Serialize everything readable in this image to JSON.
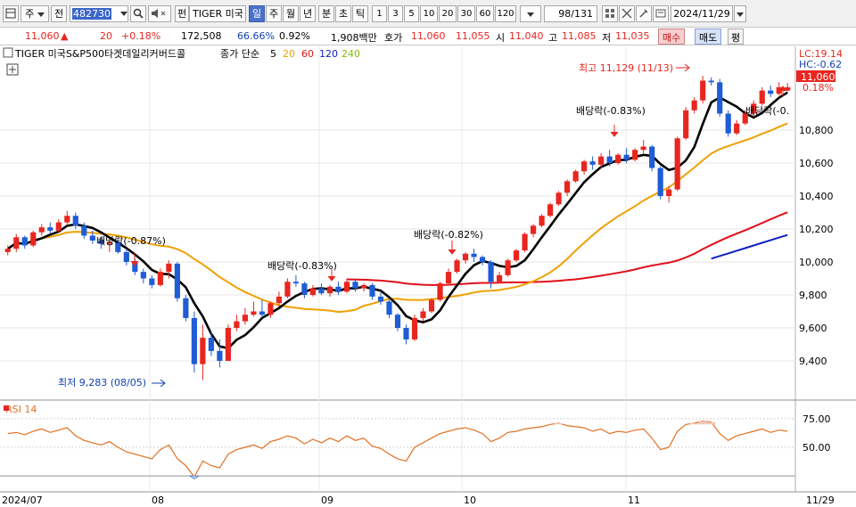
{
  "toolbar": {
    "mode_label": "주",
    "prev_label": "전",
    "code_value": "482730",
    "fund_label": "펀",
    "name_value": "TIGER 미국",
    "periods": [
      "일",
      "주",
      "월",
      "년",
      "분",
      "초",
      "틱"
    ],
    "active_period": "일",
    "counts": [
      "1",
      "3",
      "5",
      "10",
      "20",
      "30",
      "60",
      "120"
    ],
    "page_counter": "98/131",
    "date_value": "2024/11/29"
  },
  "quote": {
    "price": "11,060",
    "change": "20",
    "change_pct": "+0.18%",
    "volume": "172,508",
    "ratio1": "66.66%",
    "ratio2": "0.92%",
    "amount": "1,908백만",
    "hoga_label": "호가",
    "hoga_ask": "11,060",
    "hoga_bid": "11,055",
    "open_label": "시",
    "open": "11,040",
    "high_label": "고",
    "high": "11,085",
    "low_label": "저",
    "low": "11,035",
    "buy_label": "매수",
    "sell_label": "매도",
    "avg_label": "평"
  },
  "legend": {
    "title": "TIGER 미국S&P500타겟데일리커버드콜",
    "price_type": "종가 단순",
    "ma": [
      {
        "period": "5",
        "color": "#000000"
      },
      {
        "period": "20",
        "color": "#f0a000"
      },
      {
        "period": "60",
        "color": "#e0101a"
      },
      {
        "period": "120",
        "color": "#1020c0"
      },
      {
        "period": "240",
        "color": "#80c000"
      }
    ]
  },
  "annotations": {
    "high": "최고 11,129 (11/13)",
    "low": "최저 9,283 (08/05)",
    "div1": "배당락(-0.87%)",
    "div2": "배당락(-0.83%)",
    "div3": "배당락(-0.82%)",
    "div4": "배당락(-0.83%)",
    "div5": "배당락(-0.",
    "lc": "LC:19.14",
    "hc": "HC:-0.62",
    "last_price": "11,060",
    "last_pct": "0.18%"
  },
  "rsi": {
    "label": "RSI 14",
    "period": 14
  },
  "colors": {
    "up": "#e8261f",
    "down": "#1f5cd6",
    "ma5": "#000000",
    "ma20": "#f0a000",
    "ma60": "#e0101a",
    "ma120": "#1020c0",
    "rsi": "#e07020"
  },
  "chart_data": {
    "type": "candlestick",
    "y_ticks": [
      9400,
      9600,
      9800,
      10000,
      10200,
      10400,
      10600,
      10800
    ],
    "ylim": [
      9200,
      11200
    ],
    "x_labels": [
      "2024/07",
      "08",
      "09",
      "10",
      "11",
      "11/29"
    ],
    "rsi_ticks": [
      "75.00",
      "50.00"
    ],
    "ohlc": [
      [
        10060,
        10100,
        10040,
        10080
      ],
      [
        10080,
        10170,
        10060,
        10150
      ],
      [
        10150,
        10160,
        10080,
        10100
      ],
      [
        10100,
        10190,
        10090,
        10180
      ],
      [
        10180,
        10230,
        10160,
        10210
      ],
      [
        10210,
        10240,
        10170,
        10190
      ],
      [
        10190,
        10260,
        10180,
        10240
      ],
      [
        10240,
        10310,
        10220,
        10280
      ],
      [
        10280,
        10300,
        10200,
        10220
      ],
      [
        10220,
        10240,
        10140,
        10160
      ],
      [
        10160,
        10190,
        10110,
        10130
      ],
      [
        10130,
        10150,
        10080,
        10110
      ],
      [
        10110,
        10140,
        10060,
        10120
      ],
      [
        10120,
        10130,
        10050,
        10060
      ],
      [
        10060,
        10080,
        9980,
        10000
      ],
      [
        10000,
        10020,
        9920,
        9940
      ],
      [
        9940,
        9960,
        9870,
        9900
      ],
      [
        9900,
        9920,
        9840,
        9860
      ],
      [
        9860,
        9960,
        9850,
        9940
      ],
      [
        9940,
        10010,
        9900,
        9990
      ],
      [
        9990,
        10000,
        9760,
        9780
      ],
      [
        9780,
        9800,
        9640,
        9660
      ],
      [
        9660,
        9700,
        9330,
        9380
      ],
      [
        9380,
        9620,
        9283,
        9540
      ],
      [
        9540,
        9580,
        9430,
        9460
      ],
      [
        9460,
        9530,
        9360,
        9400
      ],
      [
        9400,
        9620,
        9400,
        9600
      ],
      [
        9600,
        9680,
        9580,
        9640
      ],
      [
        9640,
        9720,
        9620,
        9680
      ],
      [
        9680,
        9760,
        9670,
        9700
      ],
      [
        9700,
        9770,
        9660,
        9680
      ],
      [
        9680,
        9760,
        9660,
        9750
      ],
      [
        9750,
        9820,
        9730,
        9790
      ],
      [
        9790,
        9900,
        9780,
        9880
      ],
      [
        9880,
        9920,
        9850,
        9870
      ],
      [
        9870,
        9880,
        9780,
        9800
      ],
      [
        9800,
        9860,
        9790,
        9840
      ],
      [
        9840,
        9870,
        9800,
        9810
      ],
      [
        9810,
        9860,
        9790,
        9850
      ],
      [
        9850,
        9880,
        9800,
        9820
      ],
      [
        9820,
        9900,
        9810,
        9880
      ],
      [
        9880,
        9900,
        9820,
        9840
      ],
      [
        9840,
        9870,
        9820,
        9860
      ],
      [
        9860,
        9870,
        9770,
        9790
      ],
      [
        9790,
        9820,
        9740,
        9760
      ],
      [
        9760,
        9770,
        9660,
        9680
      ],
      [
        9680,
        9690,
        9580,
        9600
      ],
      [
        9600,
        9620,
        9500,
        9530
      ],
      [
        9530,
        9680,
        9520,
        9660
      ],
      [
        9660,
        9720,
        9640,
        9700
      ],
      [
        9700,
        9780,
        9690,
        9770
      ],
      [
        9770,
        9880,
        9760,
        9870
      ],
      [
        9870,
        9960,
        9860,
        9940
      ],
      [
        9940,
        10020,
        9930,
        10010
      ],
      [
        10010,
        10060,
        9990,
        10050
      ],
      [
        10050,
        10080,
        10000,
        10030
      ],
      [
        10030,
        10040,
        9980,
        10000
      ],
      [
        10000,
        10010,
        9840,
        9880
      ],
      [
        9880,
        9940,
        9870,
        9920
      ],
      [
        9920,
        10020,
        9910,
        10010
      ],
      [
        10010,
        10080,
        10000,
        10070
      ],
      [
        10070,
        10180,
        10060,
        10170
      ],
      [
        10170,
        10230,
        10150,
        10220
      ],
      [
        10220,
        10290,
        10210,
        10280
      ],
      [
        10280,
        10360,
        10270,
        10350
      ],
      [
        10350,
        10430,
        10340,
        10420
      ],
      [
        10420,
        10500,
        10400,
        10490
      ],
      [
        10490,
        10560,
        10480,
        10550
      ],
      [
        10550,
        10620,
        10530,
        10610
      ],
      [
        10610,
        10640,
        10560,
        10590
      ],
      [
        10590,
        10660,
        10570,
        10640
      ],
      [
        10640,
        10680,
        10580,
        10600
      ],
      [
        10600,
        10660,
        10590,
        10650
      ],
      [
        10650,
        10690,
        10600,
        10620
      ],
      [
        10620,
        10690,
        10610,
        10680
      ],
      [
        10680,
        10740,
        10660,
        10700
      ],
      [
        10700,
        10710,
        10550,
        10570
      ],
      [
        10570,
        10580,
        10380,
        10400
      ],
      [
        10400,
        10460,
        10360,
        10440
      ],
      [
        10440,
        10760,
        10430,
        10750
      ],
      [
        10750,
        10940,
        10740,
        10920
      ],
      [
        10920,
        11000,
        10900,
        10980
      ],
      [
        10980,
        11129,
        10960,
        11100
      ],
      [
        11100,
        11120,
        11070,
        11090
      ],
      [
        11090,
        11110,
        10880,
        10900
      ],
      [
        10900,
        10920,
        10760,
        10780
      ],
      [
        10780,
        10860,
        10770,
        10840
      ],
      [
        10840,
        10920,
        10830,
        10900
      ],
      [
        10900,
        10980,
        10880,
        10960
      ],
      [
        10960,
        11060,
        10950,
        11040
      ],
      [
        11040,
        11070,
        11000,
        11020
      ],
      [
        11020,
        11090,
        11010,
        11060
      ],
      [
        11040,
        11085,
        11035,
        11060
      ]
    ],
    "rsi_values": [
      62,
      63,
      61,
      64,
      66,
      63,
      65,
      67,
      60,
      56,
      54,
      52,
      55,
      50,
      46,
      44,
      42,
      40,
      48,
      52,
      40,
      34,
      24,
      38,
      34,
      32,
      44,
      48,
      50,
      52,
      49,
      55,
      57,
      60,
      58,
      53,
      57,
      54,
      58,
      55,
      60,
      56,
      58,
      51,
      49,
      44,
      40,
      38,
      50,
      54,
      58,
      62,
      64,
      66,
      67,
      65,
      62,
      55,
      58,
      63,
      64,
      66,
      67,
      68,
      70,
      71,
      69,
      68,
      67,
      64,
      66,
      62,
      64,
      63,
      65,
      66,
      58,
      48,
      50,
      64,
      70,
      71,
      73,
      72,
      62,
      56,
      60,
      62,
      64,
      66,
      63,
      65,
      64
    ]
  }
}
